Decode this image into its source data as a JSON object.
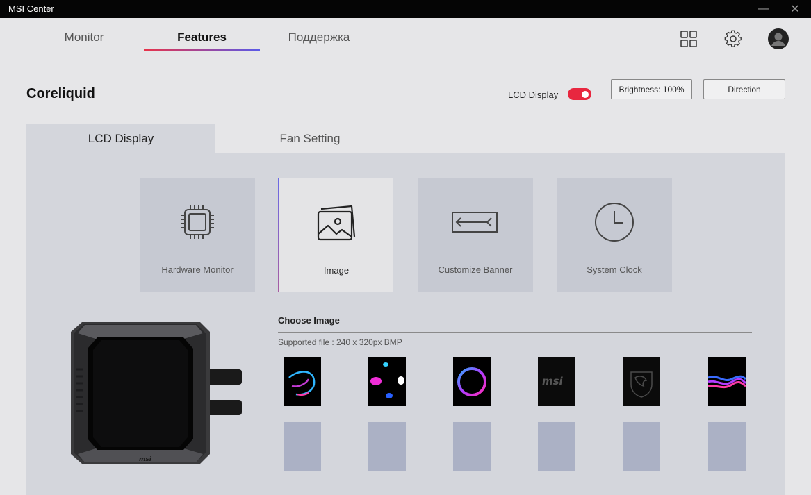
{
  "window": {
    "title": "MSI Center",
    "minimize": "—",
    "close": "✕"
  },
  "nav": {
    "tabs": [
      {
        "label": "Monitor"
      },
      {
        "label": "Features"
      },
      {
        "label": "Поддержка"
      }
    ],
    "active": "Features"
  },
  "top_icons": [
    "grid-icon",
    "gear-icon",
    "avatar"
  ],
  "page": {
    "title": "Coreliquid"
  },
  "controls": {
    "lcd_display_label": "LCD Display",
    "lcd_display_on": true,
    "brightness_label": "Brightness: 100%",
    "direction_label": "Direction"
  },
  "sub_tabs": [
    {
      "label": "LCD Display"
    },
    {
      "label": "Fan Setting"
    }
  ],
  "modes": [
    {
      "label": "Hardware Monitor",
      "icon": "cpu-chip-icon"
    },
    {
      "label": "Image",
      "icon": "image-stack-icon"
    },
    {
      "label": "Customize Banner",
      "icon": "banner-arrows-icon"
    },
    {
      "label": "System Clock",
      "icon": "clock-icon"
    }
  ],
  "selected_mode": "Image",
  "choose_image": {
    "title": "Choose Image",
    "supported": "Supported file : 240 x 320px BMP",
    "thumbnails": [
      "abstract-swirl",
      "color-blobs",
      "neon-ring",
      "msi-logo",
      "msi-dragon-shield",
      "color-wave"
    ],
    "empty_slots": 6
  },
  "colors": {
    "accent_red": "#e8273f",
    "accent_blue": "#5a5ae8",
    "panel": "#d4d6dc",
    "empty_slot": "#abb1c5"
  }
}
